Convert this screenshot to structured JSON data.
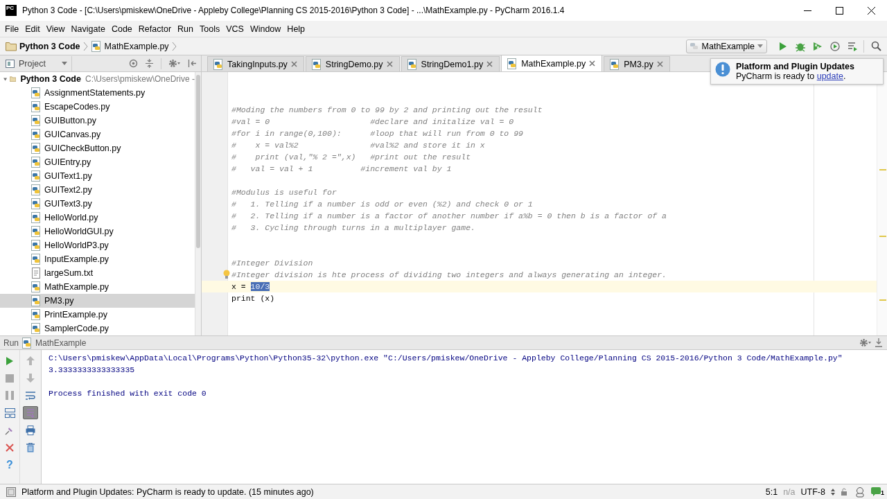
{
  "window": {
    "app_logo": "PC",
    "title": "Python 3 Code - [C:\\Users\\pmiskew\\OneDrive - Appleby College\\Planning CS 2015-2016\\Python 3 Code] - ...\\MathExample.py - PyCharm 2016.1.4"
  },
  "menu": [
    "File",
    "Edit",
    "View",
    "Navigate",
    "Code",
    "Refactor",
    "Run",
    "Tools",
    "VCS",
    "Window",
    "Help"
  ],
  "navbar": {
    "breadcrumbs": [
      {
        "label": "Python 3 Code",
        "kind": "project"
      },
      {
        "label": "MathExample.py",
        "kind": "file"
      }
    ],
    "run_config": "MathExample"
  },
  "project": {
    "view": "Project",
    "tree": [
      {
        "label": "Python 3 Code",
        "path": "C:\\Users\\pmiskew\\OneDrive -",
        "expanded": true,
        "selected": false,
        "children": [
          {
            "label": "AssignmentStatements.py",
            "kind": "py",
            "selected": false
          },
          {
            "label": "EscapeCodes.py",
            "kind": "py",
            "selected": false
          },
          {
            "label": "GUIButton.py",
            "kind": "py",
            "selected": false
          },
          {
            "label": "GUICanvas.py",
            "kind": "py",
            "selected": false
          },
          {
            "label": "GUICheckButton.py",
            "kind": "py",
            "selected": false
          },
          {
            "label": "GUIEntry.py",
            "kind": "py",
            "selected": false
          },
          {
            "label": "GUIText1.py",
            "kind": "py",
            "selected": false
          },
          {
            "label": "GUIText2.py",
            "kind": "py",
            "selected": false
          },
          {
            "label": "GUIText3.py",
            "kind": "py",
            "selected": false
          },
          {
            "label": "HelloWorld.py",
            "kind": "py",
            "selected": false
          },
          {
            "label": "HelloWorldGUI.py",
            "kind": "py",
            "selected": false
          },
          {
            "label": "HelloWorldP3.py",
            "kind": "py",
            "selected": false
          },
          {
            "label": "InputExample.py",
            "kind": "py",
            "selected": false
          },
          {
            "label": "largeSum.txt",
            "kind": "txt",
            "selected": false
          },
          {
            "label": "MathExample.py",
            "kind": "py",
            "selected": false
          },
          {
            "label": "PM3.py",
            "kind": "py",
            "selected": true
          },
          {
            "label": "PrintExample.py",
            "kind": "py",
            "selected": false
          },
          {
            "label": "SamplerCode.py",
            "kind": "py",
            "selected": false
          }
        ]
      }
    ]
  },
  "editor_tabs": [
    {
      "label": "TakingInputs.py",
      "selected": false
    },
    {
      "label": "StringDemo.py",
      "selected": false
    },
    {
      "label": "StringDemo1.py",
      "selected": false
    },
    {
      "label": "MathExample.py",
      "selected": true
    },
    {
      "label": "PM3.py",
      "selected": false
    }
  ],
  "editor": {
    "lines": [
      {
        "kind": "blank",
        "current": false
      },
      {
        "kind": "blank",
        "current": false
      },
      {
        "kind": "comment",
        "text": "#Moding the numbers from 0 to 99 by 2 and printing out the result",
        "current": false
      },
      {
        "kind": "comment",
        "text": "#val = 0                     #declare and initalize val = 0",
        "current": false
      },
      {
        "kind": "comment",
        "text": "#for i in range(0,100):      #loop that will run from 0 to 99",
        "current": false
      },
      {
        "kind": "comment",
        "text": "#    x = val%2               #val%2 and store it in x",
        "current": false
      },
      {
        "kind": "comment",
        "text": "#    print (val,\"% 2 =\",x)   #print out the result",
        "current": false
      },
      {
        "kind": "comment",
        "text": "#   val = val + 1          #increment val by 1",
        "current": false
      },
      {
        "kind": "blank",
        "current": false
      },
      {
        "kind": "comment",
        "text": "#Modulus is useful for",
        "current": false
      },
      {
        "kind": "comment",
        "text": "#   1. Telling if a number is odd or even (%2) and check 0 or 1",
        "current": false
      },
      {
        "kind": "comment",
        "text": "#   2. Telling if a number is a factor of another number if a%b = 0 then b is a factor of a",
        "current": false
      },
      {
        "kind": "comment",
        "text": "#   3. Cycling through turns in a multiplayer game.",
        "current": false
      },
      {
        "kind": "blank",
        "current": false
      },
      {
        "kind": "blank",
        "current": false
      },
      {
        "kind": "comment",
        "text": "#Integer Division",
        "current": false
      },
      {
        "kind": "comment",
        "text": "#Integer division is hte process of dividing two integers and always generating an integer.",
        "current": false,
        "bulb": true
      },
      {
        "kind": "code",
        "text": "x = ",
        "selection": "10/3",
        "current": true
      },
      {
        "kind": "code",
        "text": "print (x)",
        "current": false
      }
    ]
  },
  "notification": {
    "title": "Platform and Plugin Updates",
    "text_before": "PyCharm is ready to ",
    "link": "update",
    "text_after": "."
  },
  "run": {
    "title": "Run",
    "config": "MathExample",
    "scroll_to_end_pressed": true,
    "help": "?",
    "console": [
      {
        "kind": "command",
        "text": "C:\\Users\\pmiskew\\AppData\\Local\\Programs\\Python\\Python35-32\\python.exe \"C:/Users/pmiskew/OneDrive - Appleby College/Planning CS 2015-2016/Python 3 Code/MathExample.py\""
      },
      {
        "kind": "output",
        "text": "3.3333333333333335"
      },
      {
        "kind": "blank"
      },
      {
        "kind": "system",
        "text": "Process finished with exit code 0"
      }
    ]
  },
  "status_bar": {
    "message": "Platform and Plugin Updates: PyCharm is ready to update. (15 minutes ago)",
    "position": "5:1",
    "lock": "n/a",
    "encoding": "UTF-8",
    "event_count": "1"
  }
}
